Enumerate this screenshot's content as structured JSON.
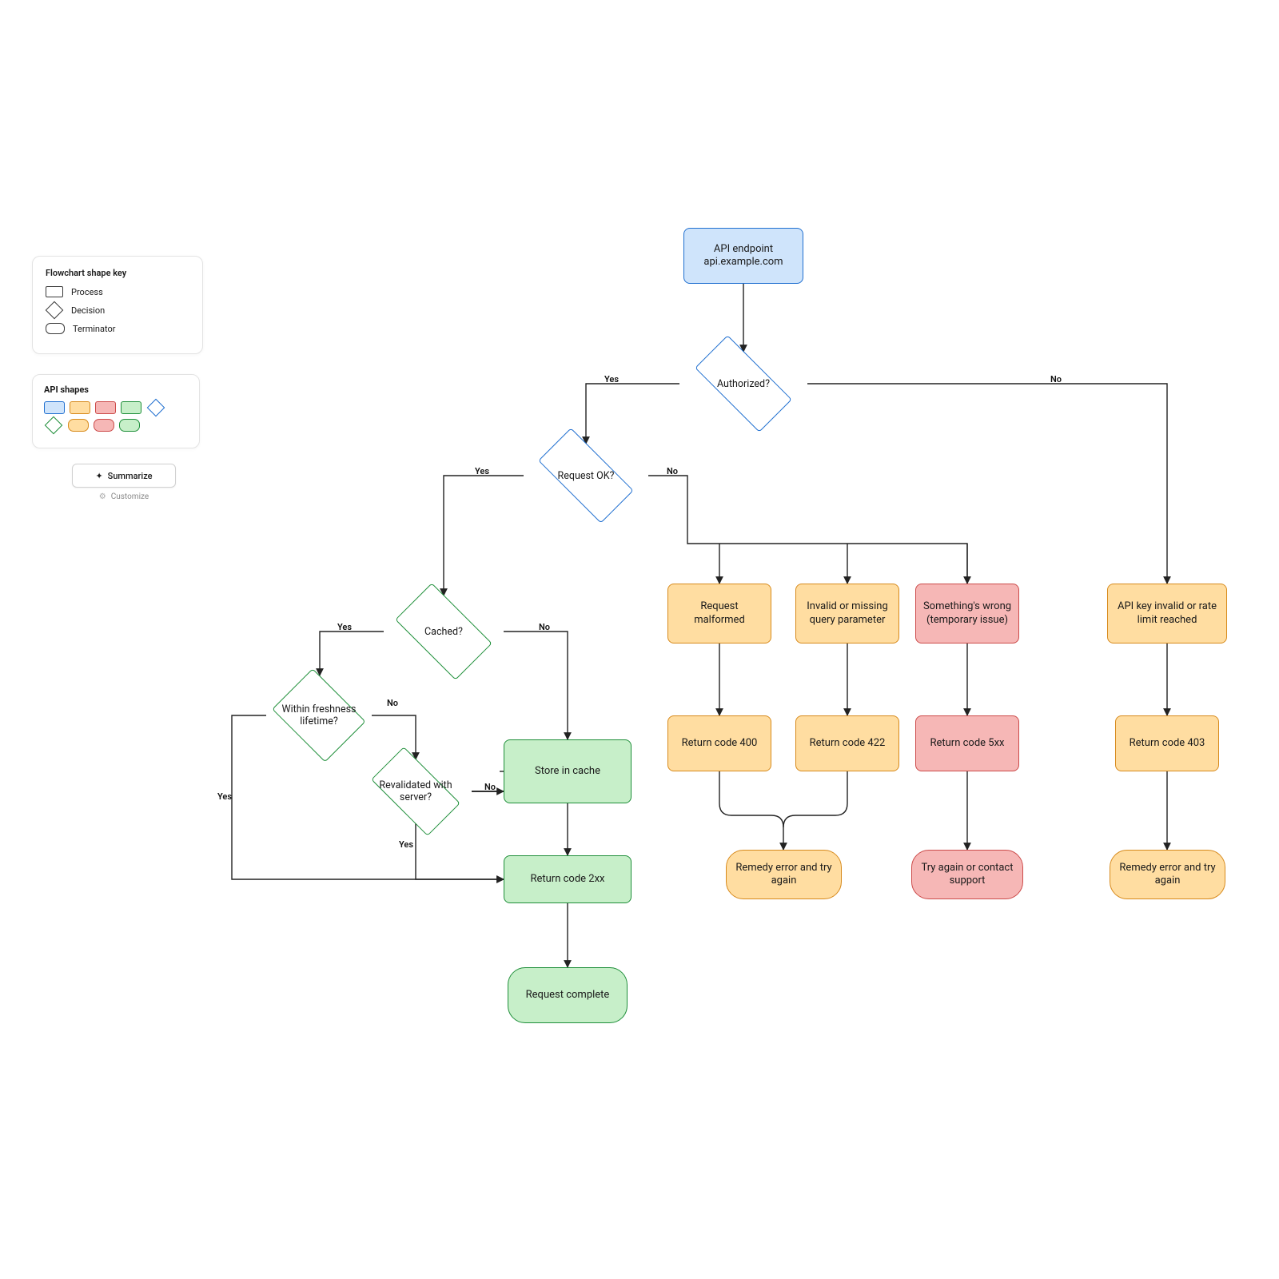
{
  "legend": {
    "title": "Flowchart shape key",
    "process": "Process",
    "decision": "Decision",
    "terminator": "Terminator"
  },
  "shapes_panel": {
    "title": "API shapes"
  },
  "controls": {
    "summarize": "Summarize",
    "customize": "Customize"
  },
  "colors": {
    "blue_fill": "#cfe4fb",
    "blue_stroke": "#1f6fd0",
    "green_fill": "#c7efc9",
    "green_stroke": "#1f8f3a",
    "orange_fill": "#ffdda1",
    "orange_stroke": "#d78a1c",
    "red_fill": "#f6b7b6",
    "red_stroke": "#cc4b4a"
  },
  "edge_labels": {
    "yes": "Yes",
    "no": "No"
  },
  "nodes": {
    "api_endpoint": "API endpoint\napi.example.com",
    "authorized": "Authorized?",
    "request_ok": "Request OK?",
    "cached": "Cached?",
    "freshness": "Within freshness lifetime?",
    "revalidated": "Revalidated with server?",
    "store_cache": "Store in cache",
    "return_2xx": "Return code 2xx",
    "request_complete": "Request complete",
    "malformed": "Request malformed",
    "invalid_param": "Invalid or missing query parameter",
    "something_wrong": "Something's wrong (temporary issue)",
    "api_key_invalid": "API key invalid or rate limit reached",
    "return_400": "Return code 400",
    "return_422": "Return code 422",
    "return_5xx": "Return code 5xx",
    "return_403": "Return code 403",
    "remedy_error": "Remedy error and try again",
    "try_support": "Try again or contact support",
    "remedy_error2": "Remedy error and try again"
  }
}
